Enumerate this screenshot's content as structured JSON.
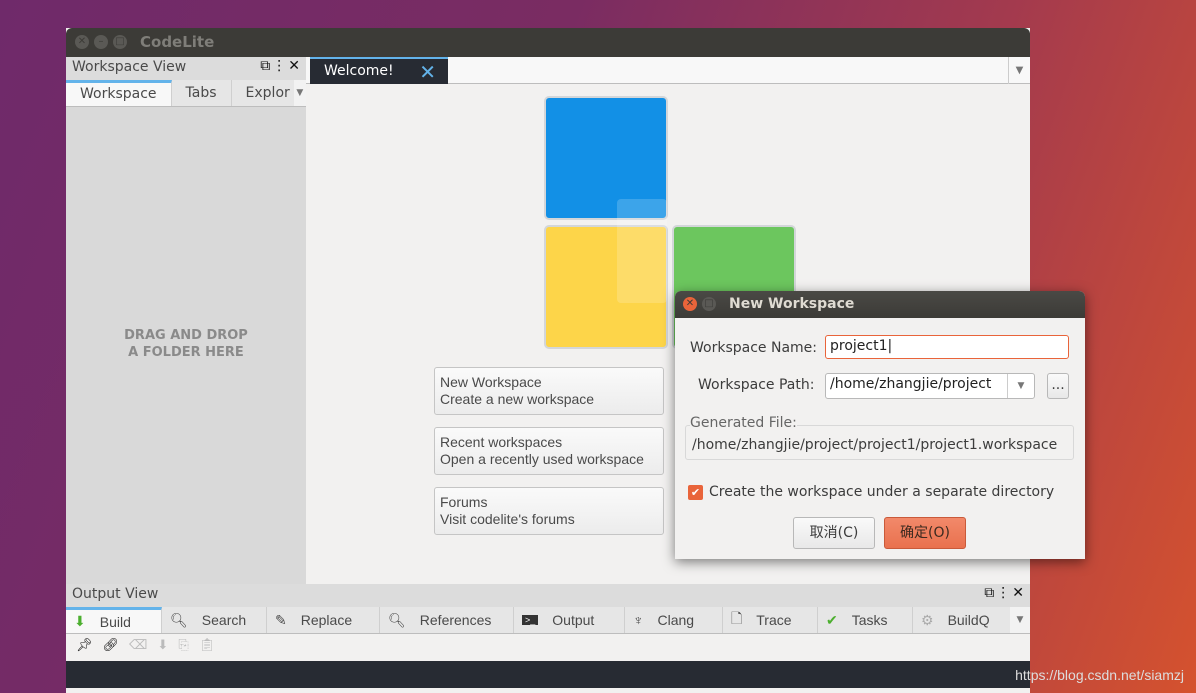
{
  "window": {
    "title": "CodeLite"
  },
  "workspace_view": {
    "title": "Workspace View",
    "tabs": [
      "Workspace",
      "Tabs",
      "Explor"
    ],
    "empty_text_line1": "DRAG AND DROP",
    "empty_text_line2": "A FOLDER HERE"
  },
  "editor": {
    "tab_label": "Welcome!"
  },
  "welcome": {
    "logo_colors": [
      "#1290e6",
      "#fdd549",
      "#6cc65e"
    ],
    "actions": [
      {
        "title": "New Workspace",
        "subtitle": "Create a new workspace"
      },
      {
        "title": "Recent workspaces",
        "subtitle": "Open a recently used workspace"
      },
      {
        "title": "Forums",
        "subtitle": "Visit codelite's forums"
      }
    ]
  },
  "output_view": {
    "title": "Output View",
    "tabs": [
      {
        "label": "Build",
        "icon": "build-icon"
      },
      {
        "label": "Search",
        "icon": "search-icon"
      },
      {
        "label": "Replace",
        "icon": "pencil-icon"
      },
      {
        "label": "References",
        "icon": "search-icon"
      },
      {
        "label": "Output",
        "icon": "terminal-icon"
      },
      {
        "label": "Clang",
        "icon": "clang-icon"
      },
      {
        "label": "Trace",
        "icon": "file-icon"
      },
      {
        "label": "Tasks",
        "icon": "tasks-icon"
      },
      {
        "label": "BuildQ",
        "icon": "gears-icon"
      }
    ]
  },
  "dialog": {
    "title": "New Workspace",
    "name_label": "Workspace Name:",
    "name_value": "project1",
    "path_label": "Workspace Path:",
    "path_value": "/home/zhangjie/project",
    "browse_label": "...",
    "generated_label": "Generated File:",
    "generated_value": "/home/zhangjie/project/project1/project1.workspace",
    "checkbox_label": "Create the workspace under a separate directory",
    "checkbox_checked": true,
    "cancel_label": "取消(C)",
    "ok_label": "确定(O)",
    "accent": "#e9643a"
  },
  "watermark": "https://blog.csdn.net/siamzj"
}
